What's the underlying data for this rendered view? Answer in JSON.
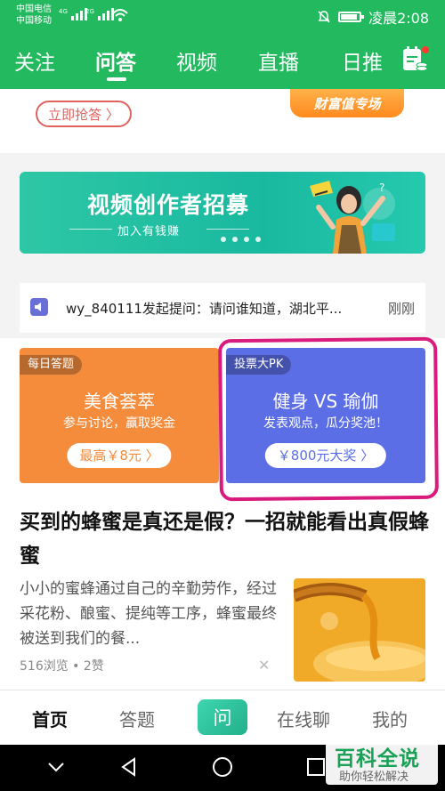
{
  "status_bar": {
    "carrier1": "中国电信",
    "carrier2": "中国移动",
    "net1": "4G",
    "net2": "2G",
    "time": "凌晨2:08"
  },
  "tabs": [
    "关注",
    "问答",
    "视频",
    "直播",
    "日推"
  ],
  "active_tab": "问答",
  "top_card": {
    "grab_button": "立即抢答 〉",
    "badge": "财富值专场"
  },
  "banner": {
    "title": "视频创作者招募",
    "subtitle": "加入有钱赚"
  },
  "notice": {
    "text": "wy_840111发起提问：请问谁知道，湖北平...",
    "time": "刚刚"
  },
  "pk_left": {
    "tag": "每日答题",
    "title": "美食荟萃",
    "subtitle": "参与讨论，赢取奖金",
    "button": "最高￥8元 〉"
  },
  "pk_right": {
    "tag": "投票大PK",
    "title": "健身 VS 瑜伽",
    "subtitle": "发表观点，瓜分奖池！",
    "button": "￥800元大奖 〉"
  },
  "article": {
    "title": "买到的蜂蜜是真还是假？一招就能看出真假蜂蜜",
    "body": "小小的蜜蜂通过自己的辛勤劳作，经过采花粉、酿蜜、提纯等工序，蜂蜜最终被送到我们的餐...",
    "stats": "516浏览 • 2赞",
    "close": "✕"
  },
  "bottom_nav": {
    "home": "首页",
    "answer": "答题",
    "ask": "问",
    "chat": "在线聊",
    "me": "我的"
  },
  "watermark": {
    "title": "百科全说",
    "subtitle": "助你轻松解决"
  },
  "colors": {
    "brand_green": "#22b95f",
    "pk_left": "#f58c3c",
    "pk_right": "#5b6ee6",
    "highlight_circle": "#d81b7c"
  }
}
